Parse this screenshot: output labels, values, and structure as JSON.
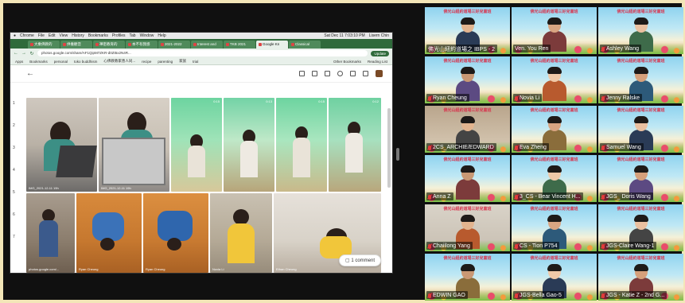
{
  "mac_menubar": {
    "apple": "",
    "items": [
      "Chrome",
      "File",
      "Edit",
      "View",
      "History",
      "Bookmarks",
      "Profiles",
      "Tab",
      "Window",
      "Help"
    ],
    "clock": "Sat Dec 11  7:03:10 PM",
    "user": "Lisern Chin"
  },
  "browser": {
    "tabs": [
      {
        "label": "大乘佛教的"
      },
      {
        "label": "供養觀音"
      },
      {
        "label": "禪密教育的"
      },
      {
        "label": "本不有我感"
      },
      {
        "label": "2021-2022"
      },
      {
        "label": "Interest and"
      },
      {
        "label": "TKB 2021"
      },
      {
        "label": "Google Kn",
        "active": true
      },
      {
        "label": "Classical"
      }
    ],
    "url": "photos.google.com/share/AF1QipM7ZKR-d0Zt5x2N4R...",
    "update_label": "Update",
    "bookmarks": [
      "Apps",
      "Bookmarks",
      "personal",
      "toko buddhism",
      "心佛教教家善人同...",
      "recipe",
      "parenting",
      "家族",
      "trial"
    ],
    "other_bookmarks": "Other Bookmarks",
    "reading_list": "Reading List"
  },
  "photos": {
    "row_numbers": [
      "1",
      "2",
      "3",
      "4",
      "5",
      "6",
      "7"
    ],
    "items": [
      {
        "caption": "IMG_2021-12-11 19h",
        "duration": ""
      },
      {
        "caption": "IMG_2021-12-11 19h",
        "duration": ""
      },
      {
        "caption": "",
        "duration": "0:15"
      },
      {
        "caption": "",
        "duration": "0:13"
      },
      {
        "caption": "",
        "duration": "0:15"
      },
      {
        "caption": "",
        "duration": "0:12"
      },
      {
        "caption": "photos.google.com/...",
        "duration": ""
      },
      {
        "caption": "Ryan Cheung",
        "duration": ""
      },
      {
        "caption": "Ryan Cheung",
        "duration": ""
      },
      {
        "caption": "Novia Li",
        "duration": ""
      },
      {
        "caption": "Ethan Cheung",
        "duration": ""
      }
    ],
    "comment_label": "1 comment"
  },
  "gallery": {
    "banner_text": "佛光山紐約道場三好兒童班",
    "participants": [
      {
        "name": "佛光山紐約道場之 IBPS - 2",
        "muted": false
      },
      {
        "name": "Ven. You Ren",
        "muted": false
      },
      {
        "name": "Ashley Wang",
        "muted": true
      },
      {
        "name": "Ryan Cheung",
        "muted": true
      },
      {
        "name": "Novia Li",
        "muted": true
      },
      {
        "name": "Jenny Ralske",
        "muted": true
      },
      {
        "name": "2CS_ARCHIE/EDWARD",
        "muted": true
      },
      {
        "name": "Eva Zheng",
        "muted": true
      },
      {
        "name": "Samuel Wang",
        "muted": true
      },
      {
        "name": "Anna Z",
        "muted": true
      },
      {
        "name": "3_CS - Bear Vincent H...",
        "muted": true
      },
      {
        "name": "JGS_ Doris Wang",
        "muted": true
      },
      {
        "name": "Chaiilong Yang",
        "muted": true
      },
      {
        "name": "CS - Tion P754",
        "muted": true
      },
      {
        "name": "JGS-Claire Wang-1",
        "muted": true
      },
      {
        "name": "EDWIN GAO",
        "muted": true
      },
      {
        "name": "JGS-Bella Gao-5",
        "muted": true
      },
      {
        "name": "JGS - Katie Z - 2nd G...",
        "muted": true
      }
    ]
  },
  "colors": {
    "frame": "#f3e6b8",
    "browser_green": "#2f6a3b",
    "banner_red": "#d8364f",
    "mic_red": "#e23b3b"
  }
}
